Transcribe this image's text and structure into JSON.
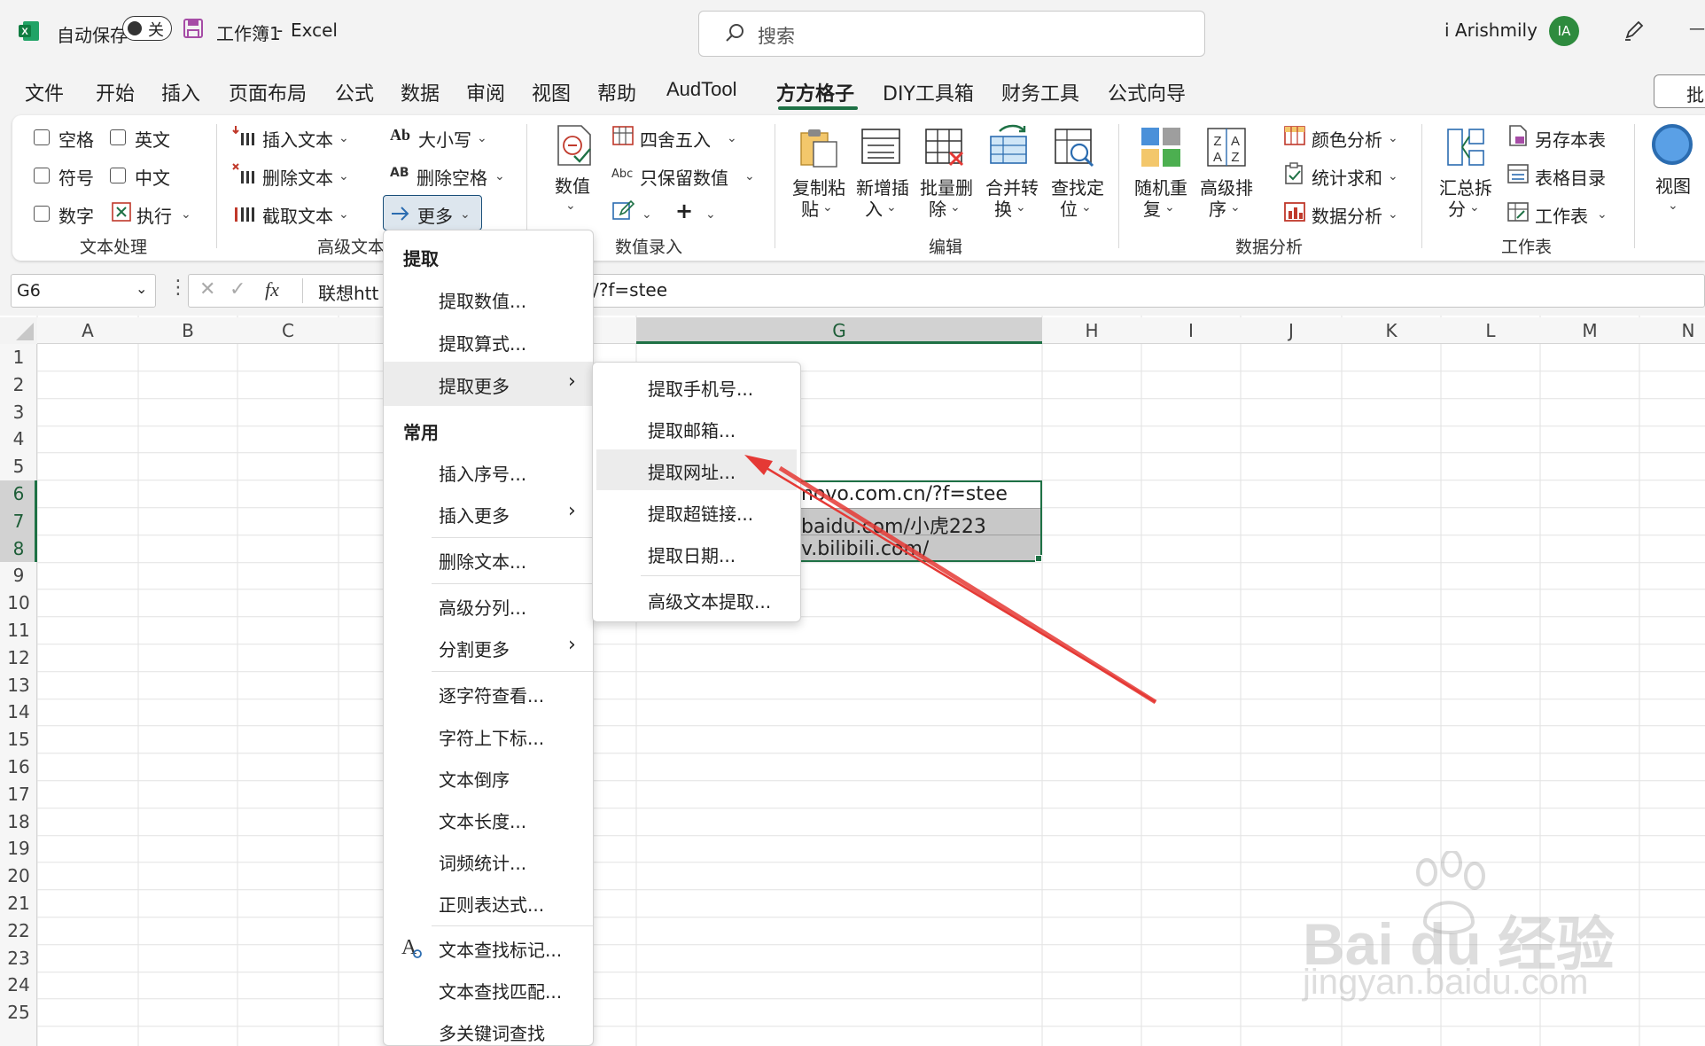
{
  "titlebar": {
    "autosave_label": "自动保存",
    "autosave_state": "关",
    "document_title": "工作簿1",
    "separator": "-",
    "app_name": "Excel",
    "search_placeholder": "搜索",
    "user_name": "i Arishmily",
    "user_initials": "IA",
    "minimize": "—"
  },
  "tabs": [
    "文件",
    "开始",
    "插入",
    "页面布局",
    "公式",
    "数据",
    "审阅",
    "视图",
    "帮助",
    "AudTool",
    "方方格子",
    "DIY工具箱",
    "财务工具",
    "公式向导"
  ],
  "share_button_label": "批",
  "ribbon": {
    "text_processing": {
      "checkboxes": [
        "空格",
        "英文",
        "符号",
        "中文",
        "数字"
      ],
      "execute": "执行",
      "group_label": "文本处理"
    },
    "advanced_text": {
      "insert_text": "插入文本",
      "delete_text": "删除文本",
      "extract_text": "截取文本",
      "case": "大小写",
      "delete_space": "删除空格",
      "more": "更多",
      "group_label": "高级文本",
      "case_icon": "Ab",
      "space_icon": "AB"
    },
    "numeric_entry": {
      "value": "数值",
      "round": "四舍五入",
      "keep_values": "只保留数值",
      "abc_icon": "Abc",
      "group_label": "数值录入"
    },
    "edit": {
      "items": [
        [
          "复制粘",
          "贴"
        ],
        [
          "新增插",
          "入"
        ],
        [
          "批量删",
          "除"
        ],
        [
          "合并转",
          "换"
        ],
        [
          "查找定",
          "位"
        ]
      ],
      "group_label": "编辑"
    },
    "data_analysis": {
      "items": [
        [
          "随机重",
          "复"
        ],
        [
          "高级排",
          "序"
        ]
      ],
      "color_analysis": "颜色分析",
      "stat_sum": "统计求和",
      "data_analysis": "数据分析",
      "group_label": "数据分析"
    },
    "worksheet": {
      "summary_split": [
        "汇总拆",
        "分"
      ],
      "save_sheet": "另存本表",
      "table_toc": "表格目录",
      "worksheet": "工作表",
      "group_label": "工作表"
    },
    "view": "视图"
  },
  "formula_bar": {
    "cell_ref": "G6",
    "fx": "fx",
    "content_left": "联想htt",
    "content_right": "/?f=stee"
  },
  "columns": [
    "A",
    "B",
    "C",
    "G",
    "H",
    "I",
    "J",
    "K",
    "L",
    "M",
    "N"
  ],
  "rows": [
    "1",
    "2",
    "3",
    "4",
    "5",
    "6",
    "7",
    "8",
    "9",
    "10",
    "11",
    "12",
    "13",
    "14",
    "15",
    "16",
    "17",
    "18",
    "19",
    "20",
    "21",
    "22",
    "23",
    "24",
    "25"
  ],
  "cells": {
    "g6": "novo.com.cn/?f=stee",
    "g7": "baidu.com/小虎223",
    "g8": "v.bilibili.com/"
  },
  "menu_main": {
    "section_extract": "提取",
    "extract_value": "提取数值...",
    "extract_formula": "提取算式...",
    "extract_more": "提取更多",
    "section_common": "常用",
    "insert_serial": "插入序号...",
    "insert_more": "插入更多",
    "delete_text": "删除文本...",
    "advanced_split": "高级分列...",
    "split_more": "分割更多",
    "char_view": "逐字符查看...",
    "superscript": "字符上下标...",
    "text_reverse": "文本倒序",
    "text_length": "文本长度...",
    "word_freq": "词频统计...",
    "regex": "正则表达式...",
    "text_find_mark": "文本查找标记...",
    "text_find_match": "文本查找匹配...",
    "multi_keyword": "多关键词查找"
  },
  "menu_sub": {
    "phone": "提取手机号...",
    "email": "提取邮箱...",
    "url": "提取网址...",
    "hyperlink": "提取超链接...",
    "date": "提取日期...",
    "advanced": "高级文本提取..."
  },
  "watermark": {
    "brand": "Bai du 经验",
    "site": "jingyan.baidu.com"
  },
  "colors": {
    "excel_green": "#1e7145",
    "avatar_green": "#2e8b3e",
    "arrow_red": "#e53935",
    "selection_fill": "#c8c8c8"
  }
}
